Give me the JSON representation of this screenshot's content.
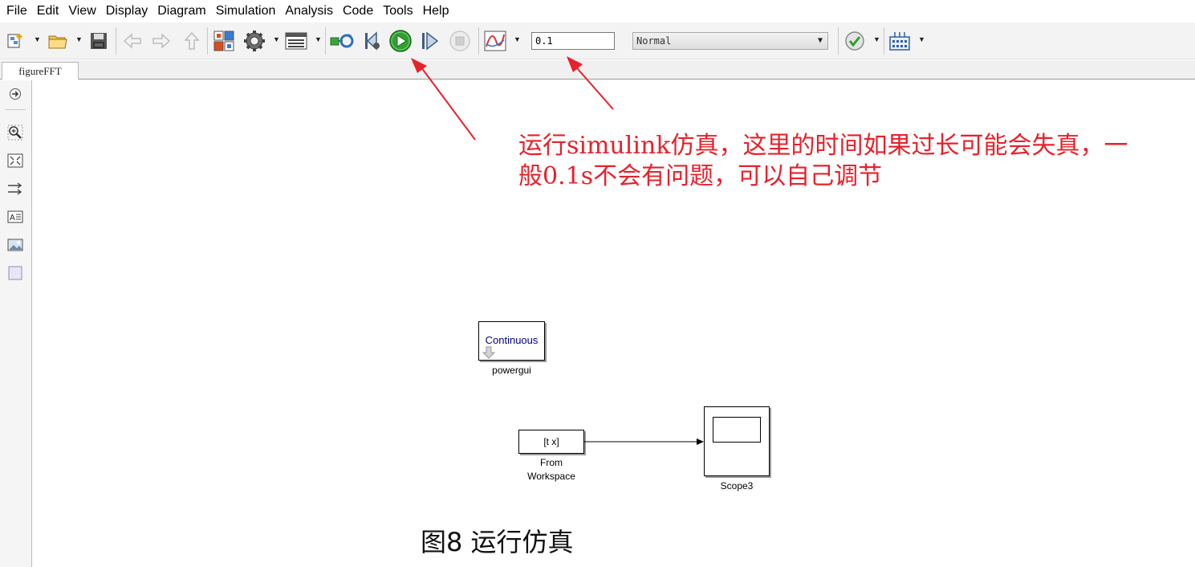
{
  "menu": {
    "file": "File",
    "edit": "Edit",
    "view": "View",
    "display": "Display",
    "diagram": "Diagram",
    "simulation": "Simulation",
    "analysis": "Analysis",
    "code": "Code",
    "tools": "Tools",
    "help": "Help"
  },
  "toolbar": {
    "stop_time": "0.1",
    "sim_mode": "Normal",
    "icons": [
      "new-model-icon",
      "open-icon",
      "save-icon",
      "back-icon",
      "forward-icon",
      "up-icon",
      "library-browser-icon",
      "model-settings-icon",
      "model-explorer-icon",
      "update-diagram-icon",
      "step-back-icon",
      "run-icon",
      "step-forward-icon",
      "stop-icon",
      "data-inspector-icon",
      "model-advisor-icon",
      "build-icon"
    ]
  },
  "tabs": {
    "model": "figureFFT"
  },
  "palette": {
    "icons": [
      "hide-palette-icon",
      "zoom-icon",
      "fit-view-icon",
      "arrow-direction-icon",
      "annotation-icon",
      "image-icon",
      "area-icon"
    ]
  },
  "diagram": {
    "powergui_text": "Continuous",
    "powergui_label": "powergui",
    "from_ws_text": "[t x]",
    "from_ws_label_1": "From",
    "from_ws_label_2": "Workspace",
    "scope_label": "Scope3"
  },
  "annotation": {
    "line1": "运行simulink仿真，这里的时间如果过长可能会失真，一",
    "line2": "般0.1s不会有问题，可以自己调节"
  },
  "caption": "图8  运行仿真",
  "colors": {
    "annotation_red": "#e8212a",
    "run_green": "#2fa12f",
    "powergui_text": "#00008b"
  }
}
